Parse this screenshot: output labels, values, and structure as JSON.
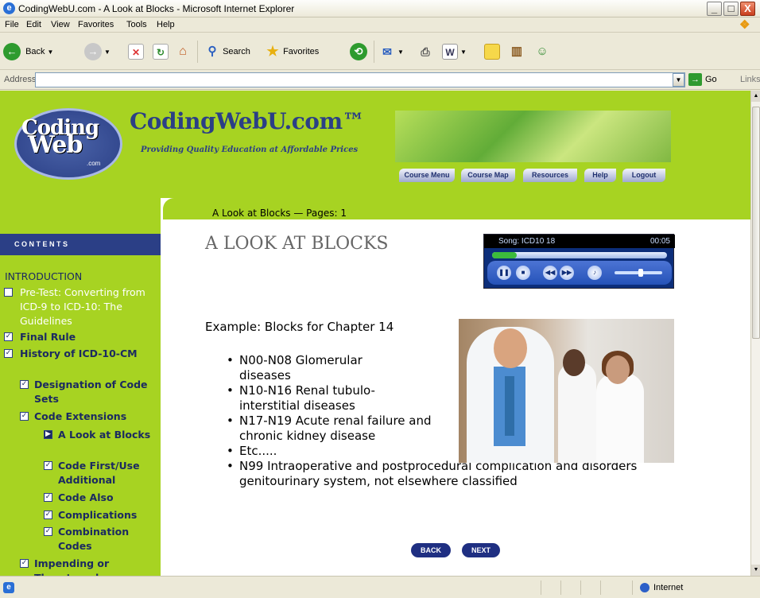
{
  "window": {
    "title": "CodingWebU.com - A Look at Blocks - Microsoft Internet Explorer",
    "min": "_",
    "max": "□",
    "close": "X"
  },
  "menu": [
    "File",
    "Edit",
    "View",
    "Favorites",
    "Tools",
    "Help"
  ],
  "toolbar": {
    "back": "Back",
    "search": "Search",
    "favorites": "Favorites"
  },
  "address": {
    "label": "Address",
    "value": "",
    "go": "Go",
    "links": "Links"
  },
  "site": {
    "logo_line1": "Coding",
    "logo_line2": "Web",
    "logo_small": ".com",
    "brand": "CodingWebU.com™",
    "tagline": "Providing Quality Education at Affordable Prices",
    "nav": [
      "Course Menu",
      "Course Map",
      "Resources",
      "Help",
      "Logout"
    ]
  },
  "pagebar": "A Look at Blocks — Pages: 1",
  "sidebar": {
    "contents": "CONTENTS",
    "intro": "INTRODUCTION",
    "items": [
      {
        "label": "Pre-Test: Converting from ICD-9 to ICD-10: The Guidelines",
        "state": "unchecked"
      },
      {
        "label": "Final Rule",
        "state": "checked"
      },
      {
        "label": "History of ICD-10-CM",
        "state": "checked"
      },
      {
        "label": "Designation of Code Sets",
        "state": "checked"
      },
      {
        "label": "Code Extensions",
        "state": "checked"
      },
      {
        "label": "A Look at Blocks",
        "state": "current"
      },
      {
        "label": "Code First/Use Additional",
        "state": "checked"
      },
      {
        "label": "Code Also",
        "state": "checked"
      },
      {
        "label": "Complications",
        "state": "checked"
      },
      {
        "label": "Combination Codes",
        "state": "checked"
      },
      {
        "label": "Impending or Threatened",
        "state": "checked"
      }
    ]
  },
  "main": {
    "heading": "A LOOK AT BLOCKS",
    "example": "Example: Blocks for Chapter 14",
    "bullets": [
      "N00-N08 Glomerular diseases",
      "N10-N16 Renal tubulo-interstitial diseases",
      "N17-N19 Acute renal failure and chronic kidney disease",
      "Etc.....",
      "N99 Intraoperative and postprocedural complication and disorders genitourinary system, not elsewhere classified"
    ],
    "back": "BACK",
    "next": "NEXT"
  },
  "player": {
    "song": "Song: ICD10 18",
    "time": "00:05",
    "progress": 0.14,
    "volume": 0.55
  },
  "status": {
    "zone": "Internet"
  },
  "colors": {
    "lime": "#a7d322",
    "navy": "#2b3f86"
  }
}
